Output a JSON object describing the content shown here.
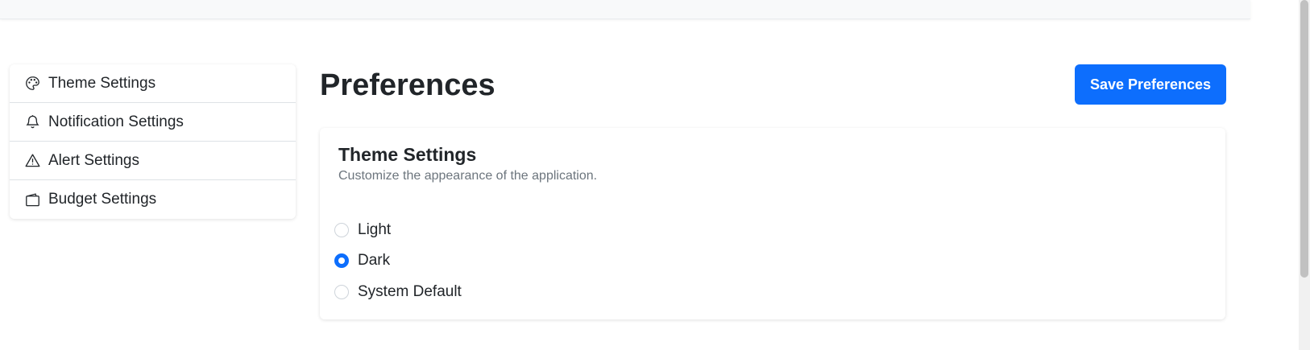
{
  "sidebar": {
    "items": [
      {
        "label": "Theme Settings",
        "icon": "palette-icon"
      },
      {
        "label": "Notification Settings",
        "icon": "bell-icon"
      },
      {
        "label": "Alert Settings",
        "icon": "warning-icon"
      },
      {
        "label": "Budget Settings",
        "icon": "wallet-icon"
      }
    ]
  },
  "main": {
    "title": "Preferences",
    "save_label": "Save Preferences"
  },
  "theme_card": {
    "title": "Theme Settings",
    "subtitle": "Customize the appearance of the application.",
    "options": [
      {
        "label": "Light",
        "selected": false
      },
      {
        "label": "Dark",
        "selected": true
      },
      {
        "label": "System Default",
        "selected": false
      }
    ]
  },
  "colors": {
    "accent": "#0d6efd",
    "text": "#212529",
    "muted": "#6c757d",
    "border": "#dee2e6"
  }
}
